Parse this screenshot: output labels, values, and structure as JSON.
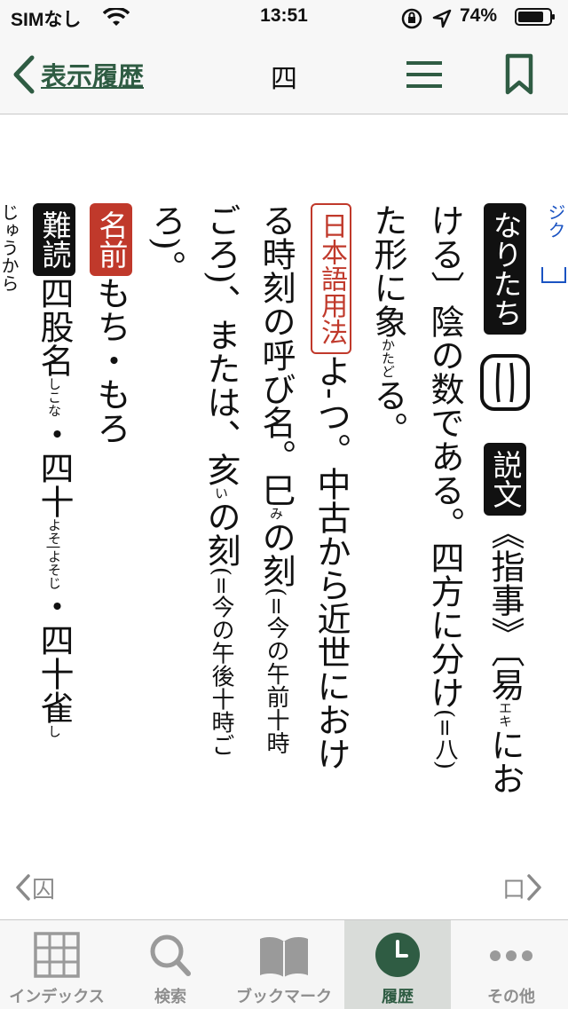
{
  "status": {
    "carrier": "SIMなし",
    "time": "13:51",
    "battery": "74%"
  },
  "nav": {
    "back_label": "表示履歴",
    "title": "四"
  },
  "entry": {
    "col1_tag": "なりたち",
    "col2_tag": "説文",
    "col2_text": "《指事》〔易",
    "col2_ruby": "エキ",
    "col2_text2": "にお",
    "col3_text": "ける〕陰の数である。四方に分け",
    "col3_small": "(=八)",
    "col4_text": "た形に象",
    "col4_ruby": "かたど",
    "col4_text2": "る。",
    "col5_tag": "日本語用法",
    "col5_text": "よ-つ。中古から近世におけ",
    "col6_text": "る時刻の呼び名。巳",
    "col6_ruby": "み",
    "col6_text2": "の刻",
    "col6_small": "(=今の午前十時",
    "col7_text": "ごろ)、または、亥",
    "col7_ruby": "い",
    "col7_text2": "の刻",
    "col7_small": "(=今の午後十時ご",
    "col8_text": "ろ)。",
    "col9_tag": "名前",
    "col9_text": "もち・もろ",
    "col10_tag": "難読",
    "col10_text1": "四股名",
    "col10_ruby1": "しこな",
    "col10_text2": "・四十",
    "col10_ruby2": "よそ|よそじ",
    "col10_text3": "・四十雀",
    "col10_ruby3": "し",
    "partial_left": "じゅうから",
    "link_fragment": "ジク"
  },
  "pager": {
    "prev_label": "囚",
    "next_label": "口"
  },
  "tabs": [
    {
      "label": "インデックス",
      "icon": "grid-icon"
    },
    {
      "label": "検索",
      "icon": "search-icon"
    },
    {
      "label": "ブックマーク",
      "icon": "book-icon"
    },
    {
      "label": "履歴",
      "icon": "clock-icon"
    },
    {
      "label": "その他",
      "icon": "more-icon"
    }
  ],
  "colors": {
    "accent": "#2f5c43",
    "red_tag": "#c0392b",
    "tab_inactive": "#8e8e8e"
  }
}
